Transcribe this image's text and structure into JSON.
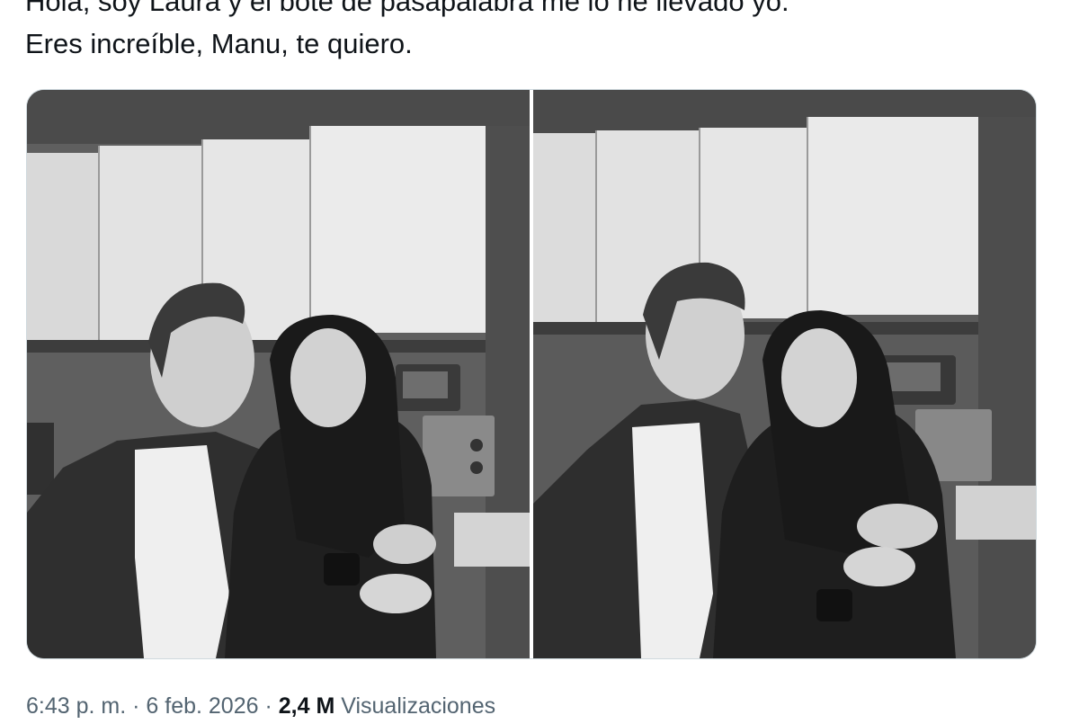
{
  "tweet": {
    "text_line1": "Hola, soy Laura y el bote de pasapalabra me lo he llevado yo.",
    "text_line2": "Eres increíble, Manu, te quiero."
  },
  "media": {
    "photos": [
      {
        "name": "photo-1",
        "scene": "couple-looking-at-each-other"
      },
      {
        "name": "photo-2",
        "scene": "couple-looking-at-camera"
      }
    ]
  },
  "meta": {
    "time": "6:43 p. m.",
    "separator": "·",
    "date": "6 feb. 2026",
    "views_count": "2,4 M",
    "views_label": "Visualizaciones"
  }
}
